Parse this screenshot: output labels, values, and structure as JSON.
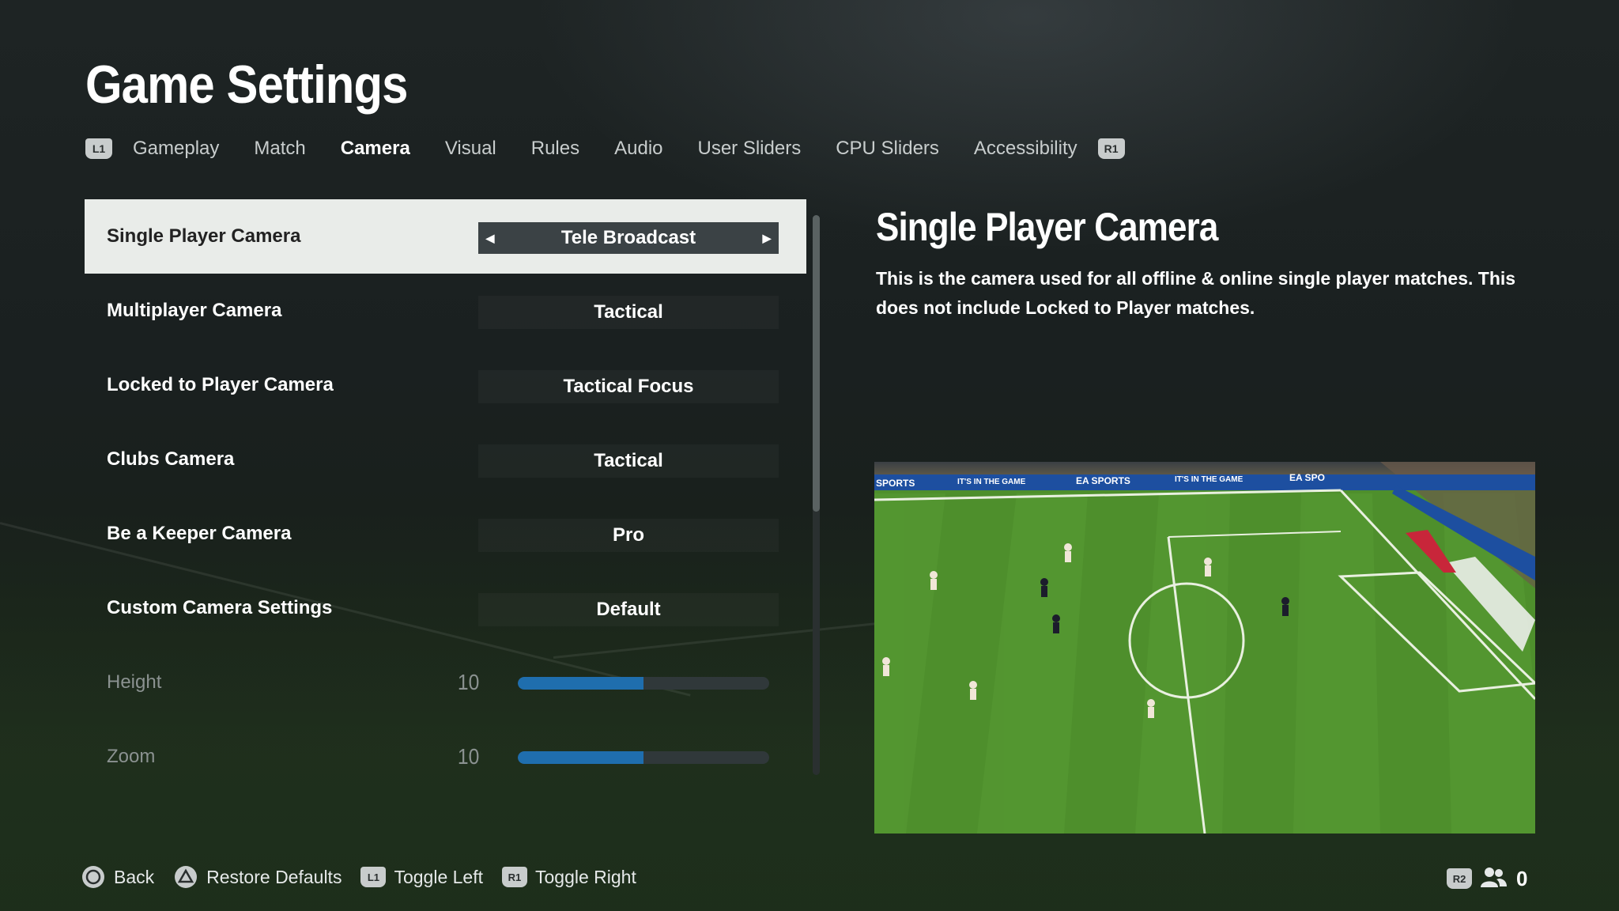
{
  "page": {
    "title": "Game Settings"
  },
  "tabs": {
    "left_bumper": "L1",
    "right_bumper": "R1",
    "items": [
      {
        "label": "Gameplay",
        "active": false
      },
      {
        "label": "Match",
        "active": false
      },
      {
        "label": "Camera",
        "active": true
      },
      {
        "label": "Visual",
        "active": false
      },
      {
        "label": "Rules",
        "active": false
      },
      {
        "label": "Audio",
        "active": false
      },
      {
        "label": "User Sliders",
        "active": false
      },
      {
        "label": "CPU Sliders",
        "active": false
      },
      {
        "label": "Accessibility",
        "active": false
      }
    ]
  },
  "settings": [
    {
      "label": "Single Player Camera",
      "value": "Tele Broadcast",
      "selected": true
    },
    {
      "label": "Multiplayer Camera",
      "value": "Tactical"
    },
    {
      "label": "Locked to Player Camera",
      "value": "Tactical Focus"
    },
    {
      "label": "Clubs Camera",
      "value": "Tactical"
    },
    {
      "label": "Be a Keeper Camera",
      "value": "Pro"
    },
    {
      "label": "Custom Camera Settings",
      "value": "Default"
    }
  ],
  "sliders": [
    {
      "label": "Height",
      "value": "10",
      "fraction": 0.5
    },
    {
      "label": "Zoom",
      "value": "10",
      "fraction": 0.5
    }
  ],
  "scroll": {
    "visible_fraction": 0.53
  },
  "detail": {
    "title": "Single Player Camera",
    "description": "This is the camera used for all offline & online single player matches. This does not include Locked to Player matches."
  },
  "preview": {
    "boards": [
      "SPORTS",
      "IT'S IN THE GAME",
      "EA SPORTS",
      "IT'S IN THE GAME",
      "EA SPO"
    ]
  },
  "footer": {
    "back": "Back",
    "restore": "Restore Defaults",
    "toggle_left_key": "L1",
    "toggle_left": "Toggle Left",
    "toggle_right_key": "R1",
    "toggle_right": "Toggle Right",
    "r2_key": "R2",
    "player_count": "0"
  },
  "colors": {
    "accent_fill": "#1f6eae",
    "selected_row": "#e9ece9",
    "pitch_green": "#4e8f2c"
  }
}
